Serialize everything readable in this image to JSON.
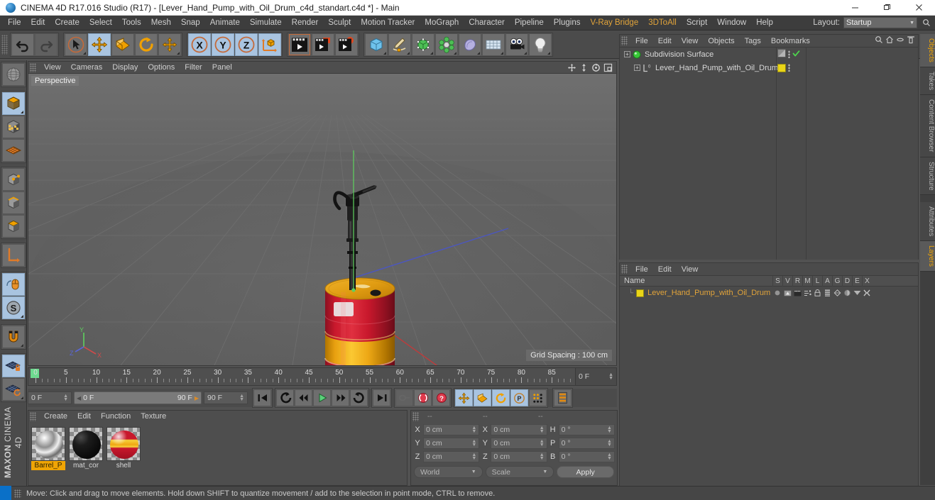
{
  "window": {
    "title": "CINEMA 4D R17.016 Studio (R17) - [Lever_Hand_Pump_with_Oil_Drum_c4d_standart.c4d *] - Main",
    "minimize": "─",
    "maximize": "❐",
    "close": "✕"
  },
  "menubar": {
    "items": [
      "File",
      "Edit",
      "Create",
      "Select",
      "Tools",
      "Mesh",
      "Snap",
      "Animate",
      "Simulate",
      "Render",
      "Sculpt",
      "Motion Tracker",
      "MoGraph",
      "Character",
      "Pipeline",
      "Plugins",
      "V-Ray Bridge",
      "3DToAll",
      "Script",
      "Window",
      "Help"
    ],
    "layout_label": "Layout:",
    "layout_value": "Startup",
    "chevron": "▼",
    "search_icon": "search-icon"
  },
  "toolbar": {
    "groups": [
      {
        "name": "history",
        "buttons": [
          {
            "name": "undo-button",
            "icon": "undo-arrow-icon",
            "state": "normal"
          },
          {
            "name": "redo-button",
            "icon": "redo-arrow-icon",
            "state": "disabled"
          }
        ]
      },
      {
        "name": "transform-tools",
        "buttons": [
          {
            "name": "live-selection-tool",
            "icon": "cursor-circle-icon",
            "state": "normal"
          },
          {
            "name": "move-tool",
            "icon": "move-arrows-icon",
            "state": "selected"
          },
          {
            "name": "scale-tool",
            "icon": "scale-box-icon",
            "state": "normal"
          },
          {
            "name": "rotate-tool",
            "icon": "rotate-ring-icon",
            "state": "normal"
          },
          {
            "name": "free-move-tool",
            "icon": "move-arrows-icon",
            "state": "normal"
          }
        ]
      },
      {
        "name": "axis-locks",
        "buttons": [
          {
            "name": "lock-x-axis-button",
            "icon": "x-axis-icon",
            "label": "X",
            "state": "selected"
          },
          {
            "name": "lock-y-axis-button",
            "icon": "y-axis-icon",
            "label": "Y",
            "state": "selected"
          },
          {
            "name": "lock-z-axis-button",
            "icon": "z-axis-icon",
            "label": "Z",
            "state": "selected"
          },
          {
            "name": "world-object-coordinates-button",
            "icon": "world-axis-cube-icon",
            "state": "normal"
          }
        ]
      },
      {
        "name": "render-tools",
        "buttons": [
          {
            "name": "render-view-button",
            "icon": "clapperboard-icon",
            "state": "normal"
          },
          {
            "name": "render-to-picture-viewer-button",
            "icon": "clapperboard-window-icon",
            "state": "normal"
          },
          {
            "name": "render-settings-button",
            "icon": "clapperboard-gear-icon",
            "state": "normal"
          }
        ]
      },
      {
        "name": "object-creation",
        "buttons": [
          {
            "name": "add-cube-button",
            "icon": "cube-icon",
            "state": "normal"
          },
          {
            "name": "add-spline-button",
            "icon": "pen-spline-icon",
            "state": "normal"
          },
          {
            "name": "add-nurbs-button",
            "icon": "green-cube-nurbs-icon",
            "state": "normal"
          },
          {
            "name": "add-array-button",
            "icon": "array-spheres-icon",
            "state": "normal"
          },
          {
            "name": "add-deformer-button",
            "icon": "bend-deformer-icon",
            "state": "normal"
          },
          {
            "name": "add-scene-object-button",
            "icon": "floor-grid-icon",
            "state": "normal"
          },
          {
            "name": "add-camera-button",
            "icon": "camera-icon",
            "state": "normal"
          },
          {
            "name": "add-light-button",
            "icon": "lightbulb-icon",
            "state": "normal"
          }
        ]
      }
    ]
  },
  "leftbar": {
    "groups": [
      [
        {
          "name": "make-editable-button",
          "icon": "globe-wireframe-icon",
          "state": "normal"
        }
      ],
      [
        {
          "name": "model-mode-button",
          "icon": "model-cube-icon",
          "state": "selected"
        },
        {
          "name": "texture-mode-button",
          "icon": "texture-checker-cube-icon",
          "state": "normal"
        },
        {
          "name": "uv-mesh-mode-button",
          "icon": "uv-grid-diamond-icon",
          "state": "normal"
        }
      ],
      [
        {
          "name": "points-mode-button",
          "icon": "points-cube-icon",
          "state": "normal"
        },
        {
          "name": "edges-mode-button",
          "icon": "edges-cube-icon",
          "state": "normal"
        },
        {
          "name": "polygons-mode-button",
          "icon": "polygon-cube-icon",
          "state": "normal"
        }
      ],
      [
        {
          "name": "axis-modify-button",
          "icon": "axis-l-icon",
          "state": "normal"
        }
      ],
      [
        {
          "name": "viewport-solo-button",
          "icon": "mouse-orange-icon",
          "state": "selected"
        },
        {
          "name": "snap-settings-button",
          "icon": "letter-s-circle-icon",
          "state": "selected"
        }
      ],
      [
        {
          "name": "magnet-tool-button",
          "icon": "magnet-icon",
          "state": "normal"
        }
      ],
      [
        {
          "name": "lock-workplane-button",
          "icon": "grid-lock-icon",
          "state": "selected"
        },
        {
          "name": "workplane-rotate-button",
          "icon": "grid-rotate-icon",
          "state": "normal"
        }
      ]
    ],
    "brand_line1": "MAXON",
    "brand_line2": "CINEMA 4D"
  },
  "viewport": {
    "menus": [
      "View",
      "Cameras",
      "Display",
      "Options",
      "Filter",
      "Panel"
    ],
    "nav_icons": [
      "pan-icon",
      "dolly-icon",
      "orbit-icon",
      "maximize-view-icon"
    ],
    "label": "Perspective",
    "grid_spacing": "Grid Spacing : 100 cm",
    "scene": {
      "object": "Lever Hand Pump with Oil Drum",
      "drum_colors": {
        "red": "#c0182b",
        "yellow": "#f2a613",
        "top": "#e8a317"
      },
      "pump_color": "#141414",
      "axis_colors": {
        "x": "#d13a3a",
        "y": "#4ec44e",
        "z": "#4a55c8"
      }
    }
  },
  "timeline": {
    "start": 0,
    "end": 90,
    "step": 5,
    "playhead_frame": 0,
    "current_field": "0 F"
  },
  "animbar": {
    "start_field": "0 F",
    "range_left": "0 F",
    "range_right": "90 F",
    "end_field": "90 F",
    "buttons": [
      {
        "name": "go-to-start-button",
        "icon": "skip-start-icon"
      },
      {
        "name": "go-to-previous-key-button",
        "icon": "rewind-key-icon"
      },
      {
        "name": "go-to-previous-frame-button",
        "icon": "step-back-icon"
      },
      {
        "name": "play-button",
        "icon": "play-icon"
      },
      {
        "name": "go-to-next-frame-button",
        "icon": "step-forward-icon"
      },
      {
        "name": "go-to-next-key-button",
        "icon": "forward-key-icon"
      },
      {
        "name": "go-to-end-button",
        "icon": "skip-end-icon"
      }
    ],
    "record_buttons": [
      {
        "name": "autokeying-button",
        "icon": "key-disabled-icon",
        "state": "disabled"
      },
      {
        "name": "record-active-objects-button",
        "icon": "record-red-icon",
        "state": "normal"
      },
      {
        "name": "autokeying-toggle-button",
        "icon": "question-red-icon",
        "state": "normal"
      }
    ],
    "key_toggles": [
      {
        "name": "key-position-button",
        "icon": "move-arrows-icon",
        "state": "selected"
      },
      {
        "name": "key-scale-button",
        "icon": "scale-box-icon",
        "state": "selected"
      },
      {
        "name": "key-rotation-button",
        "icon": "rotate-ring-icon",
        "state": "selected"
      },
      {
        "name": "key-parameter-button",
        "icon": "letter-p-circle-icon",
        "state": "selected"
      },
      {
        "name": "key-point-level-animation-button",
        "icon": "pla-dots-icon",
        "state": "normal"
      }
    ],
    "timeline_toggle": {
      "name": "timeline-layout-button",
      "icon": "timeline-bars-icon"
    }
  },
  "material_manager": {
    "menus": [
      "Create",
      "Edit",
      "Function",
      "Texture"
    ],
    "materials": [
      {
        "name": "Barrel_P",
        "selected": true,
        "swatch": "metallic"
      },
      {
        "name": "mat_cor",
        "selected": false,
        "swatch": "black"
      },
      {
        "name": "shell",
        "selected": false,
        "swatch": "striped"
      }
    ]
  },
  "coordinate_manager": {
    "headers": [
      "--",
      "--",
      "--"
    ],
    "rows": [
      {
        "label_pos": "X",
        "value_pos": "0 cm",
        "label_size": "X",
        "value_size": "0 cm",
        "label_rot": "H",
        "value_rot": "0 °"
      },
      {
        "label_pos": "Y",
        "value_pos": "0 cm",
        "label_size": "Y",
        "value_size": "0 cm",
        "label_rot": "P",
        "value_rot": "0 °"
      },
      {
        "label_pos": "Z",
        "value_pos": "0 cm",
        "label_size": "Z",
        "value_size": "0 cm",
        "label_rot": "B",
        "value_rot": "0 °"
      }
    ],
    "coord_system": "World",
    "size_mode": "Scale",
    "apply_label": "Apply",
    "chevron": "▼"
  },
  "object_manager": {
    "menus": [
      "File",
      "Edit",
      "View",
      "Objects",
      "Tags",
      "Bookmarks"
    ],
    "header_icons": [
      "search-icon",
      "home-icon",
      "minus-icon",
      "expand-icon"
    ],
    "rows": [
      {
        "name": "Subdivision Surface",
        "indent": 0,
        "icon": "subdivision-surface-icon",
        "expander": "+",
        "tag_color": null,
        "has_check": true
      },
      {
        "name": "Lever_Hand_Pump_with_Oil_Drum",
        "indent": 1,
        "icon": "null-object-icon",
        "expander": "+",
        "tag_color": "#ead517",
        "has_check": false
      }
    ]
  },
  "layer_manager": {
    "menus": [
      "File",
      "Edit",
      "View"
    ],
    "name_column": "Name",
    "columns": [
      "S",
      "V",
      "R",
      "M",
      "L",
      "A",
      "G",
      "D",
      "E",
      "X"
    ],
    "rows": [
      {
        "name": "Lever_Hand_Pump_with_Oil_Drum",
        "color": "#ead517"
      }
    ]
  },
  "right_tabs": {
    "top": [
      {
        "label": "Objects",
        "active": true
      },
      {
        "label": "Takes",
        "active": false
      },
      {
        "label": "Content Browser",
        "active": false
      },
      {
        "label": "Structure",
        "active": false
      }
    ],
    "bottom": [
      {
        "label": "Attributes",
        "active": false
      },
      {
        "label": "Layers",
        "active": true
      }
    ]
  },
  "statusbar": {
    "message": "Move: Click and drag to move elements. Hold down SHIFT to quantize movement / add to the selection in point mode, CTRL to remove."
  }
}
